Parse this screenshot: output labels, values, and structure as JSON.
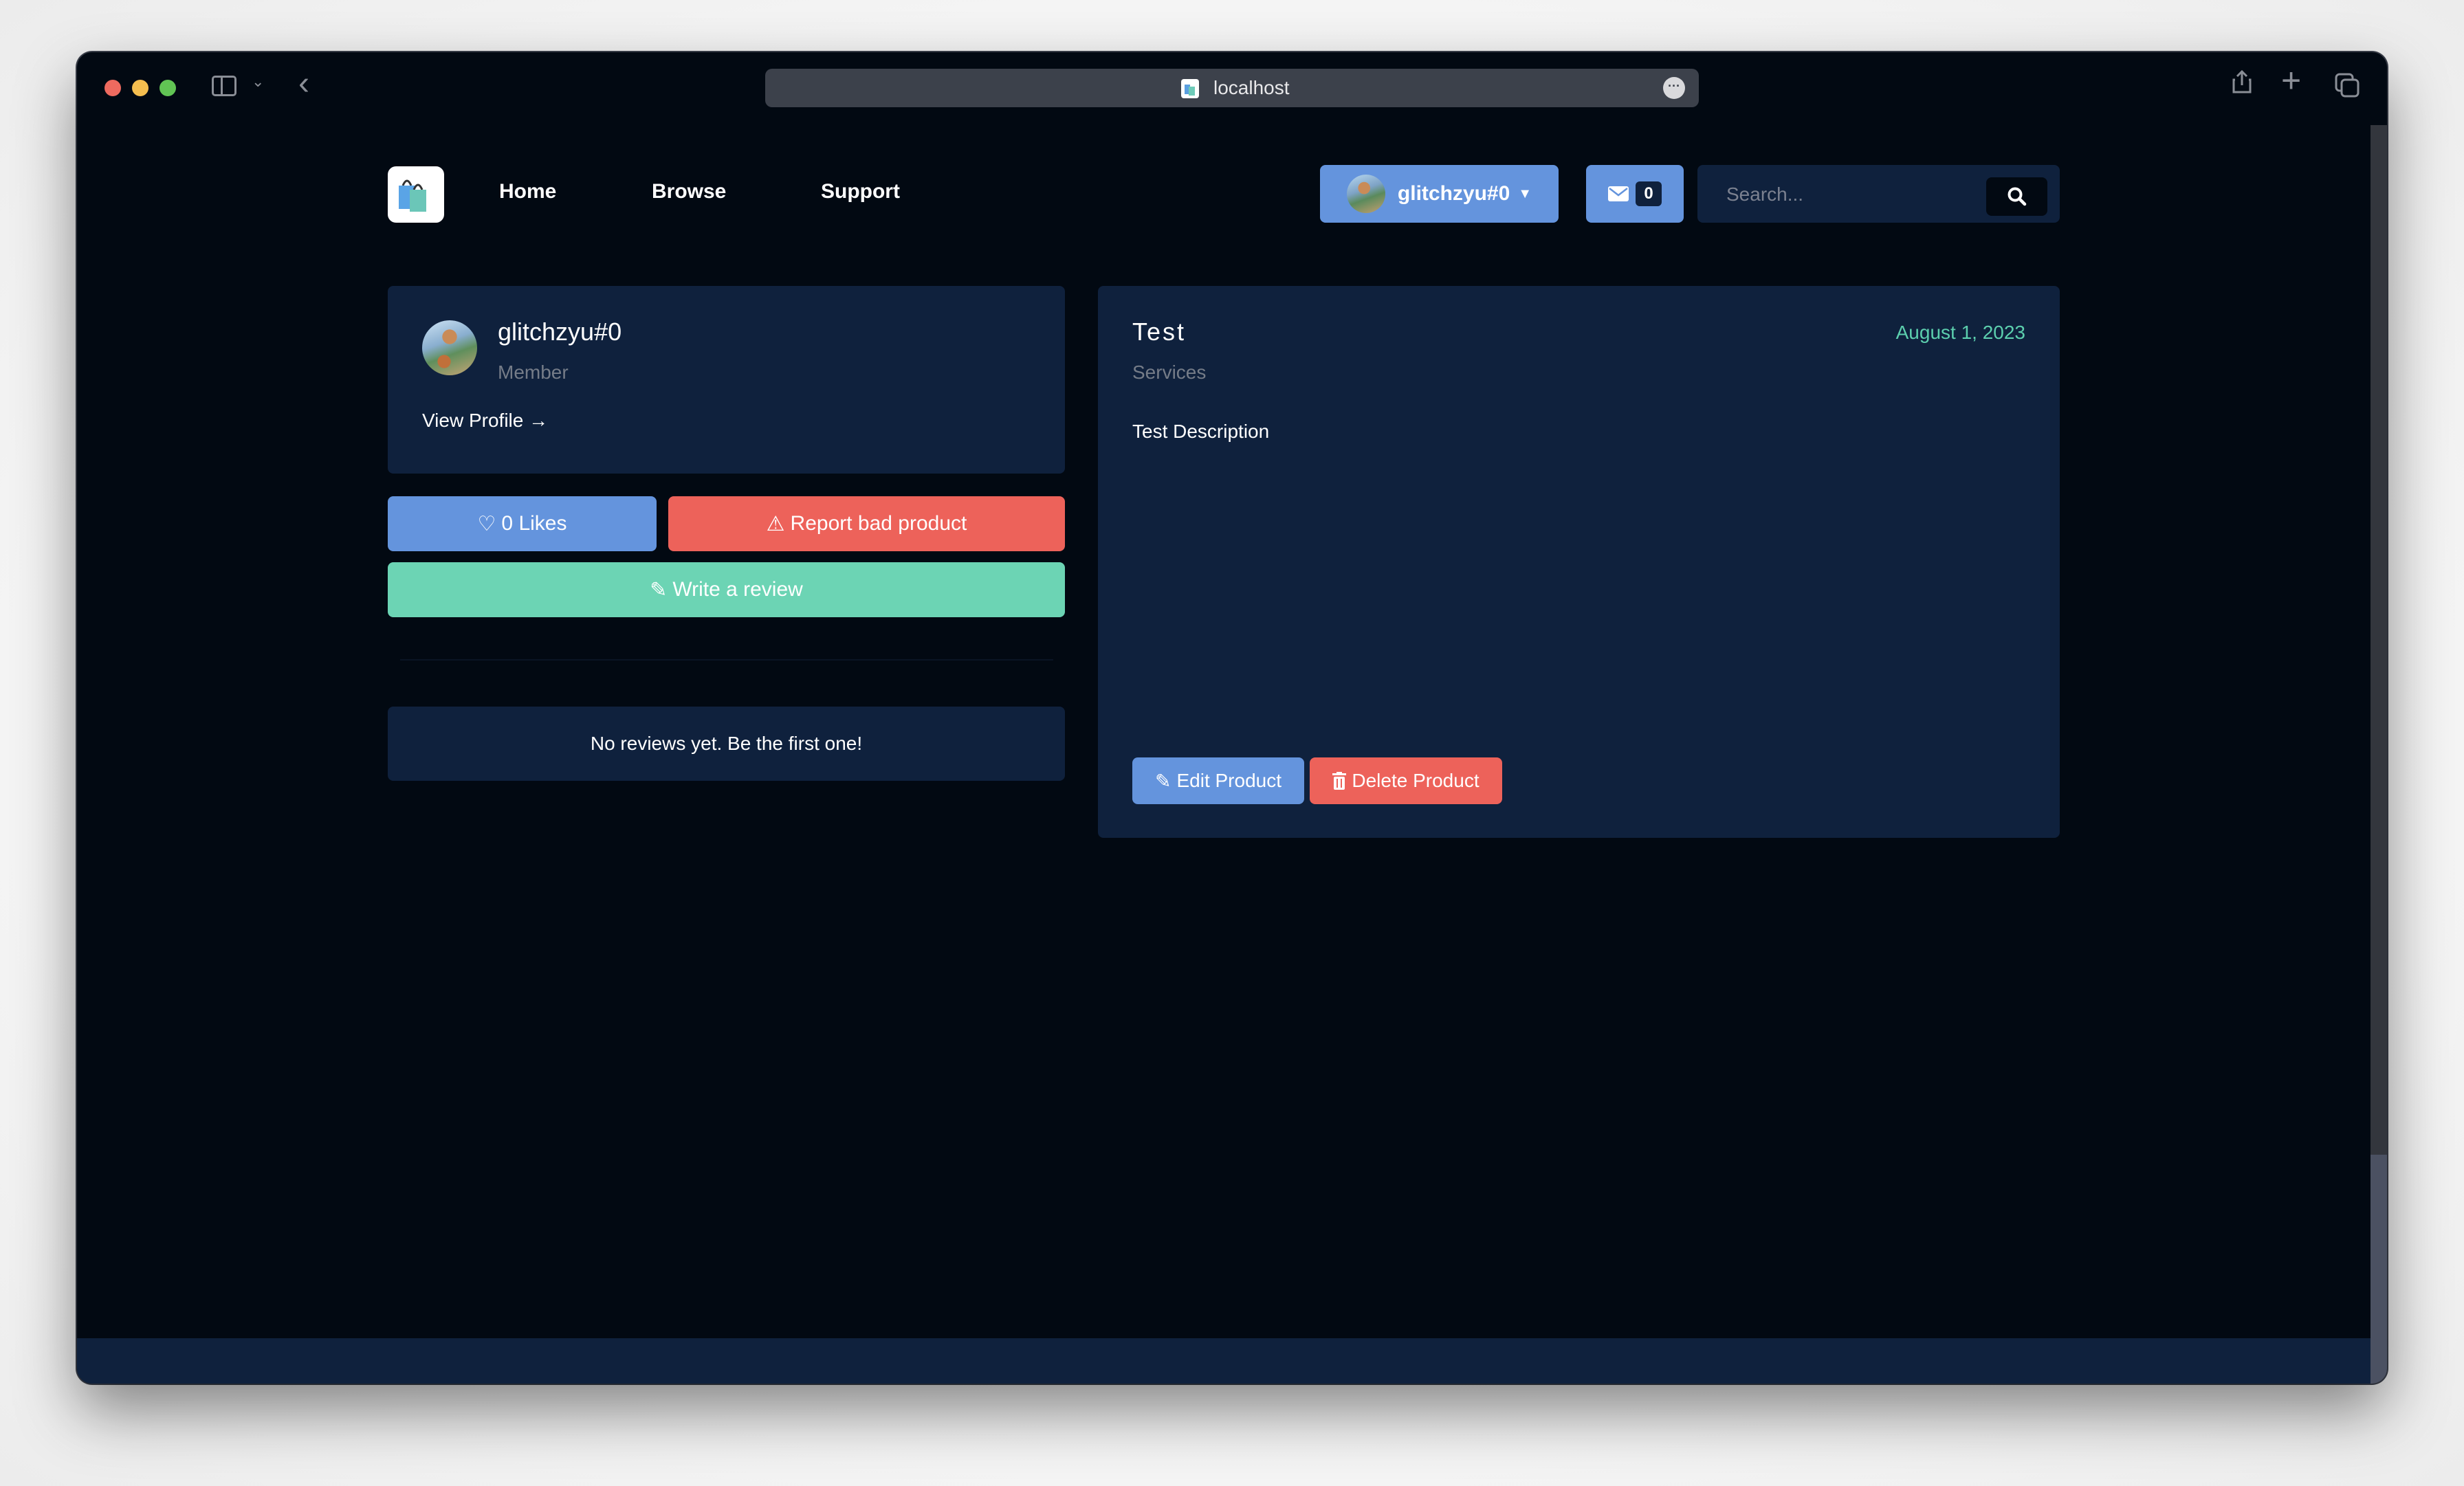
{
  "browser": {
    "url": "localhost",
    "colors": {
      "close": "#ee6a5f",
      "minimize": "#f5be4f",
      "maximize": "#61c454"
    }
  },
  "nav": {
    "links": [
      "Home",
      "Browse",
      "Support"
    ],
    "user": {
      "name": "glitchzyu#0"
    },
    "messages": {
      "count": "0"
    },
    "search": {
      "placeholder": "Search..."
    }
  },
  "profile": {
    "name": "glitchzyu#0",
    "role": "Member",
    "view_profile_label": "View Profile"
  },
  "actions": {
    "likes_label": "0 Likes",
    "report_label": "Report bad product",
    "review_label": "Write a review"
  },
  "reviews": {
    "empty_text": "No reviews yet. Be the first one!"
  },
  "product": {
    "title": "Test",
    "date": "August 1, 2023",
    "category": "Services",
    "description": "Test Description",
    "edit_label": "Edit Product",
    "delete_label": "Delete Product"
  },
  "colors": {
    "background": "#020912",
    "card": "#0f213d",
    "primary": "#6494dd",
    "danger": "#ed625a",
    "success": "#6cd4b4",
    "date_accent": "#5ccfae"
  }
}
